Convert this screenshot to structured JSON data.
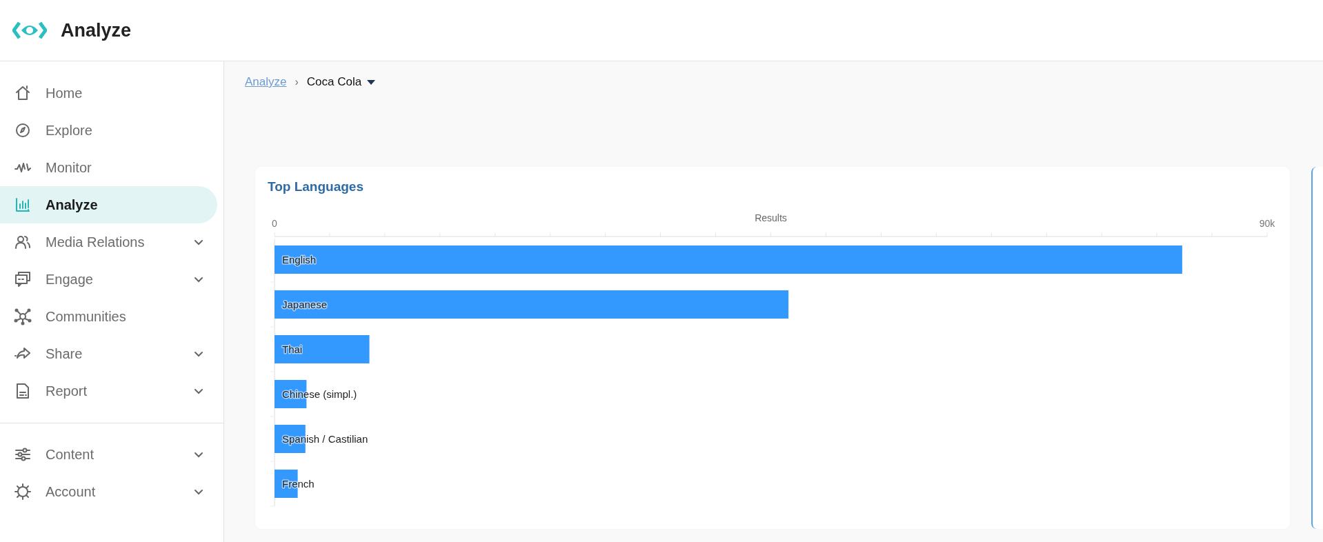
{
  "app": {
    "title": "Analyze"
  },
  "sidebar": {
    "sections": [
      {
        "items": [
          {
            "label": "Home",
            "selected": false,
            "has_submenu": false
          },
          {
            "label": "Explore",
            "selected": false,
            "has_submenu": false
          },
          {
            "label": "Monitor",
            "selected": false,
            "has_submenu": false
          },
          {
            "label": "Analyze",
            "selected": true,
            "has_submenu": false
          },
          {
            "label": "Media Relations",
            "selected": false,
            "has_submenu": true
          },
          {
            "label": "Engage",
            "selected": false,
            "has_submenu": true
          },
          {
            "label": "Communities",
            "selected": false,
            "has_submenu": false
          },
          {
            "label": "Share",
            "selected": false,
            "has_submenu": true
          },
          {
            "label": "Report",
            "selected": false,
            "has_submenu": true
          }
        ]
      },
      {
        "items": [
          {
            "label": "Content",
            "selected": false,
            "has_submenu": true
          },
          {
            "label": "Account",
            "selected": false,
            "has_submenu": true
          }
        ]
      }
    ]
  },
  "breadcrumb": {
    "separator": "›",
    "items": [
      {
        "label": "Analyze",
        "kind": "link"
      },
      {
        "label": "Coca Cola",
        "kind": "dropdown"
      }
    ]
  },
  "card": {
    "chart_data": {
      "type": "bar",
      "orientation": "horizontal",
      "title": "Top Languages",
      "xlabel": "Results",
      "categories": [
        "English",
        "Japanese",
        "Thai",
        "Chinese (simpl.)",
        "Spanish / Castilian",
        "French"
      ],
      "series": [
        {
          "color": "#3399ff",
          "values": [
            82300,
            46600,
            8600,
            2900,
            2800,
            2100
          ]
        }
      ],
      "xlim": [
        0,
        90000
      ],
      "xticks": [
        {
          "value": 0,
          "label": "0"
        },
        {
          "value": 90000,
          "label": "90k"
        }
      ]
    }
  }
}
